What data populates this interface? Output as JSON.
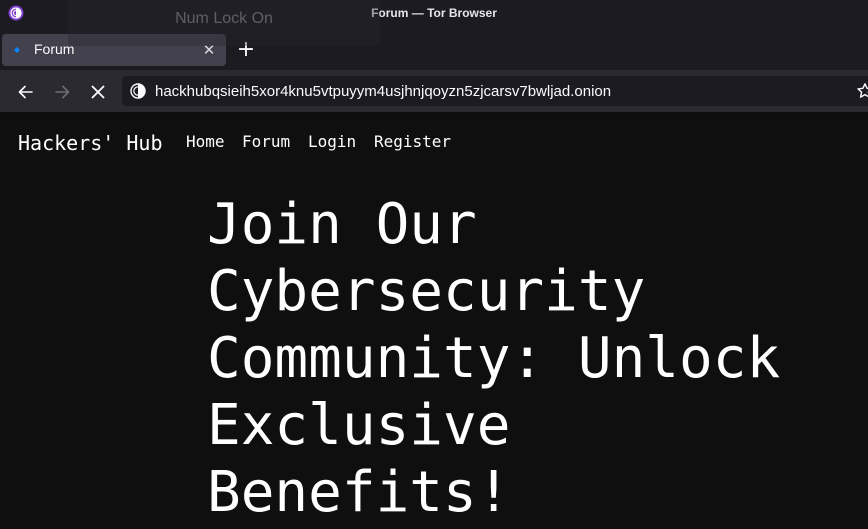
{
  "window": {
    "title": "Forum — Tor Browser",
    "osd_message": "Num Lock On"
  },
  "tabs": [
    {
      "label": "Forum",
      "active": true
    }
  ],
  "toolbar": {
    "url": "hackhubqsieih5xor4knu5vtpuyym4usjhnjqoyzn5zjcarsv7bwljad.onion",
    "loading": true
  },
  "site": {
    "name": "Hackers' Hub",
    "nav": [
      "Home",
      "Forum",
      "Login",
      "Register"
    ],
    "hero_heading": "Join Our Cybersecurity Community: Unlock Exclusive Benefits!"
  },
  "colors": {
    "page_background": "#0f0f10",
    "text": "#ffffff",
    "chrome_dark": "#1c1b22",
    "chrome_toolbar": "#2b2a33",
    "tab_active": "#42414d",
    "tor_purple": "#7e3fd1",
    "favicon_blue": "#0a84ff"
  },
  "icons": {
    "window_logo": "tor-browser-icon",
    "tab_favicon": "dot-favicon-icon",
    "tab_close": "close-icon",
    "new_tab": "plus-icon",
    "back": "arrow-left-icon",
    "forward": "arrow-right-icon",
    "stop": "stop-x-icon",
    "onion": "onion-icon",
    "bookmark": "star-icon"
  }
}
